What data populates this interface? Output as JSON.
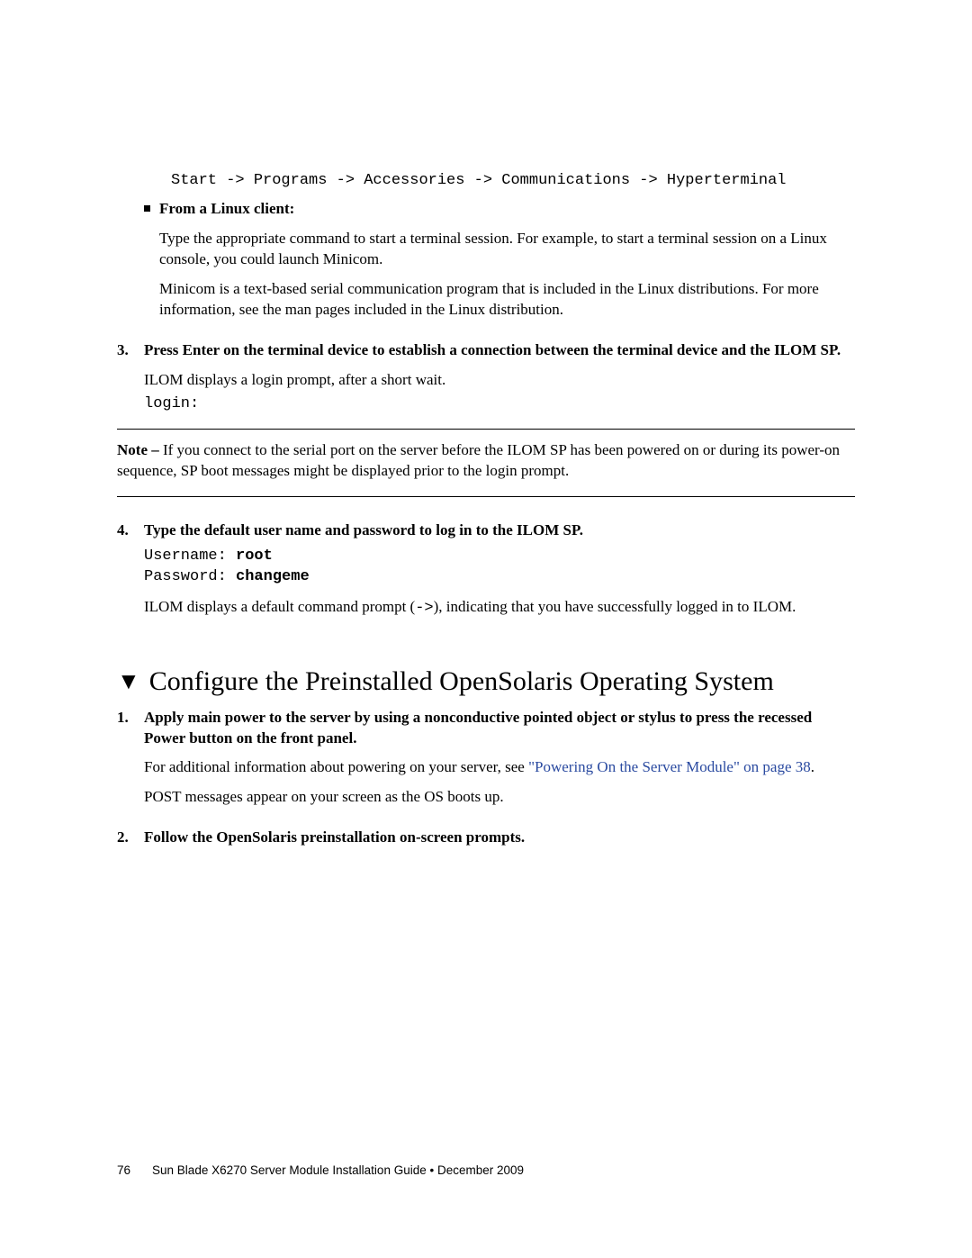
{
  "top_code": "Start -> Programs -> Accessories -> Communications -> Hyperterminal",
  "linux_bullet": "From a Linux client:",
  "linux_p1": "Type the appropriate command to start a terminal session. For example, to start a terminal session on a Linux console, you could launch Minicom.",
  "linux_p2": "Minicom is a text-based serial communication program that is included in the Linux distributions. For more information, see the man pages included in the Linux distribution.",
  "step3_num": "3.",
  "step3_title": "Press Enter on the terminal device to establish a connection between the terminal device and the ILOM SP.",
  "step3_p1": "ILOM displays a login prompt, after a short wait.",
  "step3_code": "login:",
  "note_label": "Note – ",
  "note_body": "If you connect to the serial port on the server before the ILOM SP has been powered on or during its power-on sequence, SP boot messages might be displayed prior to the login prompt.",
  "step4_num": "4.",
  "step4_title": "Type the default user name and password to log in to the ILOM SP.",
  "user_label": "Username: ",
  "user_val": "root",
  "pass_label": "Password: ",
  "pass_val": "changeme",
  "step4_p1a": "ILOM displays a default command prompt (",
  "step4_p1_code": "->",
  "step4_p1b": "), indicating that you have successfully logged in to ILOM.",
  "section_title": "Configure the Preinstalled OpenSolaris Operating System",
  "s2_step1_num": "1.",
  "s2_step1_title": "Apply main power to the server by using a nonconductive pointed object or stylus to press the recessed Power button on the front panel.",
  "s2_step1_p1a": "For additional information about powering on your server, see ",
  "s2_step1_link": "\"Powering On the Server Module\" on page 38",
  "s2_step1_p1b": ".",
  "s2_step1_p2": "POST messages appear on your screen as the OS boots up.",
  "s2_step2_num": "2.",
  "s2_step2_title": "Follow the OpenSolaris preinstallation on-screen prompts.",
  "footer_page": "76",
  "footer_text": "Sun Blade X6270 Server Module Installation Guide • December 2009"
}
